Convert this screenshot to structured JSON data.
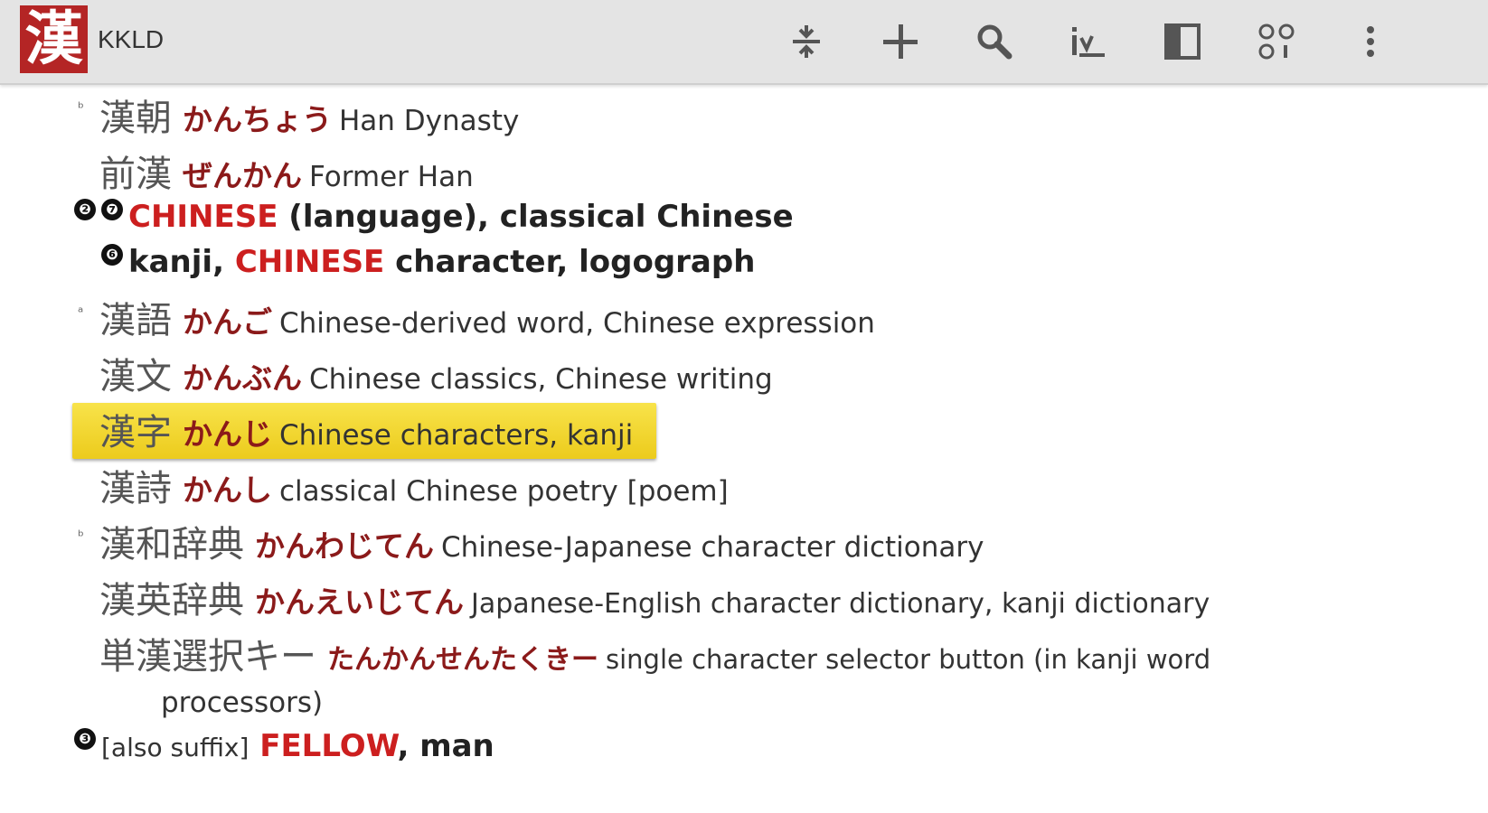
{
  "app": {
    "logo_char": "漢",
    "title": "KKLD"
  },
  "toolbar": {
    "icons": [
      "collapse-icon",
      "add-icon",
      "search-icon",
      "lookup-icon",
      "panel-icon",
      "grid-icon",
      "overflow-menu-icon"
    ]
  },
  "entries": {
    "e1": {
      "kanji": "漢朝",
      "kana": "かんちょう",
      "gloss": "Han Dynasty",
      "marker": "ᵇ"
    },
    "e2": {
      "kanji": "前漢",
      "kana": "ぜんかん",
      "gloss": "Former Han"
    },
    "sense2": {
      "nums": [
        "❷",
        "❼"
      ],
      "keyword": "CHINESE",
      "rest": " (language), classical Chinese"
    },
    "sense2b": {
      "num": "❻",
      "pre": "kanji, ",
      "keyword": "CHINESE",
      "rest": " character, logograph"
    },
    "e3": {
      "kanji": "漢語",
      "kana": "かんご",
      "gloss": "Chinese-derived word, Chinese expression",
      "marker": "ᵃ"
    },
    "e4": {
      "kanji": "漢文",
      "kana": "かんぶん",
      "gloss": "Chinese classics, Chinese writing"
    },
    "e5": {
      "kanji": "漢字",
      "kana": "かんじ",
      "gloss": "Chinese characters, kanji"
    },
    "e6": {
      "kanji": "漢詩",
      "kana": "かんし",
      "gloss": "classical Chinese poetry [poem]"
    },
    "e7": {
      "kanji": "漢和辞典",
      "kana": "かんわじてん",
      "gloss": "Chinese-Japanese character dictionary",
      "marker": "ᵇ"
    },
    "e8": {
      "kanji": "漢英辞典",
      "kana": "かんえいじてん",
      "gloss": "Japanese-English character dictionary, kanji dictionary"
    },
    "e9": {
      "kanji": "単漢選択キー",
      "kana": "たんかんせんたくきー",
      "gloss": "single character selector button (in kanji word",
      "gloss_cont": "processors)"
    },
    "sense3": {
      "num": "❸",
      "note": "[also suffix]",
      "keyword": "FELLOW",
      "rest": ", man"
    }
  }
}
